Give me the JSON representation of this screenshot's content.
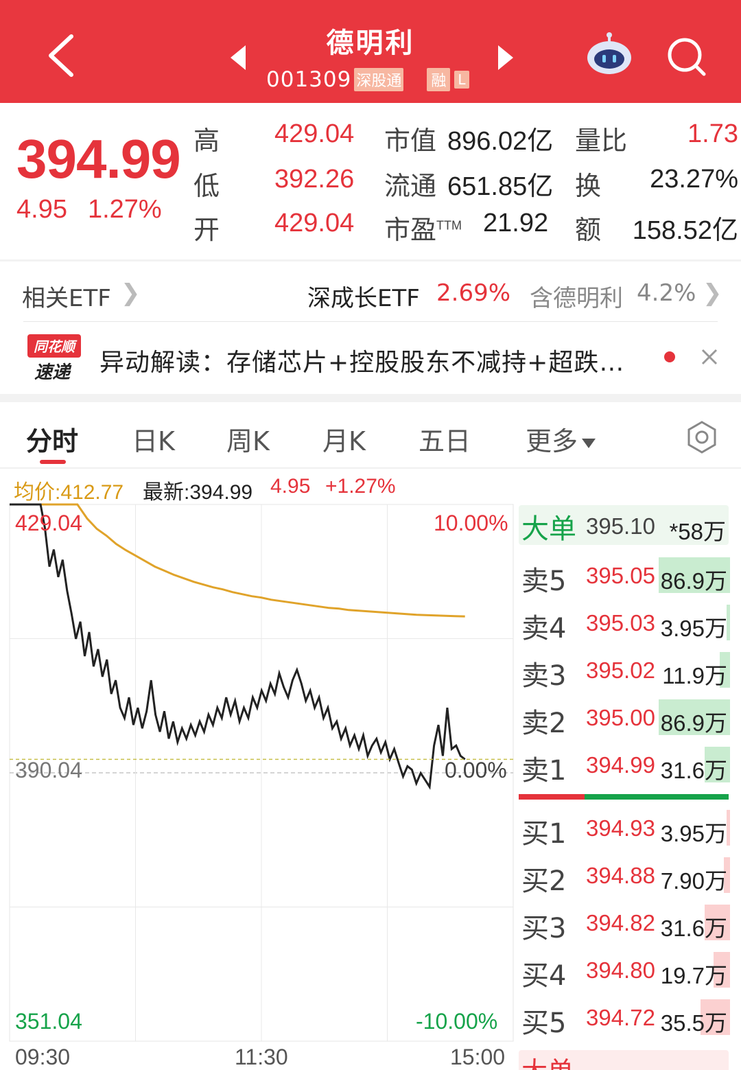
{
  "header": {
    "stock_name": "德明利",
    "stock_code": "001309",
    "tag_connect": "深股通",
    "tag_margin": "融",
    "tag_l": "L"
  },
  "quote": {
    "price": "394.99",
    "change": "4.95",
    "change_pct": "1.27%",
    "high_label": "高",
    "high": "429.04",
    "low_label": "低",
    "low": "392.26",
    "open_label": "开",
    "open": "429.04",
    "mktcap_label": "市值",
    "mktcap": "896.02亿",
    "float_label": "流通",
    "float": "651.85亿",
    "pe_label": "市盈",
    "pe_sup": "TTM",
    "pe": "21.92",
    "volratio_label": "量比",
    "volratio": "1.73",
    "turnover_label": "换",
    "turnover": "23.27%",
    "amount_label": "额",
    "amount": "158.52亿"
  },
  "etf": {
    "label": "相关ETF",
    "name": "深成长ETF",
    "pct": "2.69%",
    "contains": "含德明利",
    "weight": "4.2%"
  },
  "news": {
    "logo_top": "同花顺",
    "logo_bottom": "速递",
    "text": "异动解读：存储芯片+控股股东不减持+超跌…"
  },
  "tabs": [
    "分时",
    "日K",
    "周K",
    "月K",
    "五日",
    "更多"
  ],
  "legend": {
    "avg": "均价:412.77",
    "latest": "最新:394.99",
    "change": "4.95",
    "pct": "+1.27%"
  },
  "axis": {
    "y_top": "429.04",
    "y_mid": "390.04",
    "y_bottom": "351.04",
    "pct_top": "10.00%",
    "pct_mid": "0.00%",
    "pct_bottom": "-10.00%",
    "x_start": "09:30",
    "x_mid": "11:30",
    "x_end": "15:00"
  },
  "colors": {
    "brand_red": "#e8373f",
    "up_red": "#e5333b",
    "down_green": "#16a34a",
    "avg_line": "#e0a32a",
    "price_line": "#222222"
  },
  "orderbook": {
    "big_order": {
      "label": "大单",
      "price": "395.10",
      "vol": "*58万"
    },
    "asks": [
      {
        "label": "卖5",
        "price": "395.05",
        "vol": "86.9万",
        "level": 1.0
      },
      {
        "label": "卖4",
        "price": "395.03",
        "vol": "3.95万",
        "level": 0.05
      },
      {
        "label": "卖3",
        "price": "395.02",
        "vol": "11.9万",
        "level": 0.14
      },
      {
        "label": "卖2",
        "price": "395.00",
        "vol": "86.9万",
        "level": 1.0
      },
      {
        "label": "卖1",
        "price": "394.99",
        "vol": "31.6万",
        "level": 0.36
      }
    ],
    "bids": [
      {
        "label": "买1",
        "price": "394.93",
        "vol": "3.95万",
        "level": 0.05
      },
      {
        "label": "买2",
        "price": "394.88",
        "vol": "7.90万",
        "level": 0.09
      },
      {
        "label": "买3",
        "price": "394.82",
        "vol": "31.6万",
        "level": 0.36
      },
      {
        "label": "买4",
        "price": "394.80",
        "vol": "19.7万",
        "level": 0.23
      },
      {
        "label": "买5",
        "price": "394.72",
        "vol": "35.5万",
        "level": 0.41
      }
    ],
    "big_order_bottom": {
      "label": "大单"
    }
  },
  "chart_data": {
    "type": "line",
    "ylim": [
      351.04,
      429.04
    ],
    "prev_close": 390.04,
    "x_ticks": [
      "09:30",
      "11:30",
      "15:00"
    ],
    "series": [
      {
        "name": "最新",
        "values": [
          429.04,
          429.04,
          429.04,
          429.04,
          429.04,
          429.04,
          429.04,
          429.04,
          425.6,
          420.0,
          422.5,
          418.5,
          421.0,
          416.5,
          413.2,
          409.5,
          412.0,
          407.0,
          410.5,
          405.5,
          408.0,
          404.0,
          406.5,
          401.5,
          403.5,
          399.5,
          398.0,
          401.0,
          397.0,
          399.5,
          396.5,
          399.0,
          403.5,
          398.5,
          396.0,
          399.0,
          395.0,
          397.5,
          394.5,
          396.5,
          395.0,
          397.0,
          395.5,
          397.5,
          396.0,
          398.5,
          397.0,
          399.5,
          398.0,
          401.0,
          398.5,
          400.5,
          397.5,
          399.5,
          398.0,
          401.0,
          399.5,
          402.0,
          400.5,
          403.0,
          401.5,
          404.5,
          402.5,
          401.0,
          403.5,
          405.0,
          403.0,
          400.5,
          402.0,
          399.5,
          401.0,
          398.0,
          399.5,
          396.5,
          397.5,
          395.0,
          396.5,
          394.0,
          395.5,
          393.5,
          395.5,
          392.5,
          394.0,
          395.0,
          393.0,
          394.5,
          392.0,
          393.5,
          391.5,
          389.5,
          391.0,
          390.5,
          388.5,
          390.0,
          389.0,
          388.0,
          394.0,
          397.0,
          392.5,
          399.5,
          393.5,
          394.0,
          392.5,
          392.0
        ]
      },
      {
        "name": "均价",
        "values": [
          429.04,
          429.04,
          429.04,
          429.04,
          429.04,
          429.04,
          429.04,
          429.04,
          427.0,
          425.5,
          424.5,
          423.3,
          422.4,
          421.6,
          420.8,
          420.0,
          419.4,
          418.8,
          418.3,
          417.8,
          417.4,
          417.0,
          416.7,
          416.3,
          416.0,
          415.7,
          415.5,
          415.2,
          415.0,
          414.8,
          414.6,
          414.4,
          414.2,
          414.0,
          413.9,
          413.7,
          413.6,
          413.5,
          413.4,
          413.3,
          413.2,
          413.1,
          413.0,
          412.95,
          412.9,
          412.85,
          412.8,
          412.77
        ]
      }
    ]
  }
}
